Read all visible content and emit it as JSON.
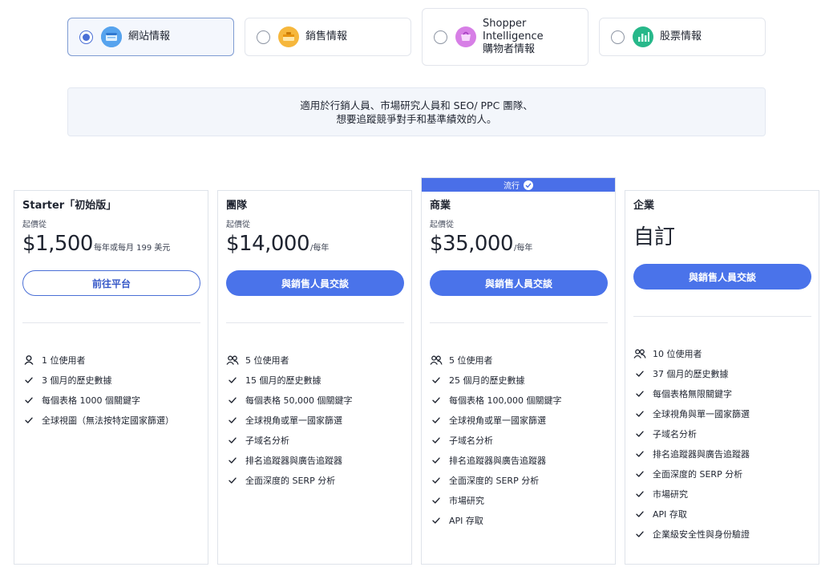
{
  "product_tabs": [
    {
      "label": "網站情報",
      "selected": true,
      "icon": "website-icon"
    },
    {
      "label": "銷售情報",
      "selected": false,
      "icon": "sales-icon"
    },
    {
      "label": "Shopper\nIntelligence\n購物者情報",
      "selected": false,
      "icon": "shopper-icon"
    },
    {
      "label": "股票情報",
      "selected": false,
      "icon": "stock-icon"
    }
  ],
  "banner": {
    "line1": "適用於行銷人員、市場研究人員和 SEO/ PPC 團隊、",
    "line2": "想要追蹤競爭對手和基準績效的人。"
  },
  "popular_label": "流行",
  "plans": [
    {
      "name": "Starter「初始版」",
      "price_from": "起價從",
      "price": "$1,500",
      "price_suffix": "每年或每月 199 美元",
      "cta": "前往平台",
      "features": [
        {
          "icon": "user-icon",
          "text": "1 位使用者"
        },
        {
          "icon": "check-icon",
          "text": "3 個月的歷史數據"
        },
        {
          "icon": "check-icon",
          "text": "每個表格 1000 個關鍵字"
        },
        {
          "icon": "check-icon",
          "text": "全球視圖（無法按特定國家篩選）"
        }
      ]
    },
    {
      "name": "團隊",
      "price_from": "起價從",
      "price": "$14,000",
      "price_suffix": "/每年",
      "cta": "與銷售人員交談",
      "features": [
        {
          "icon": "users-icon",
          "text": "5 位使用者"
        },
        {
          "icon": "check-icon",
          "text": "15 個月的歷史數據"
        },
        {
          "icon": "check-icon",
          "text": "每個表格 50,000 個關鍵字"
        },
        {
          "icon": "check-icon",
          "text": "全球視角或單一國家篩選"
        },
        {
          "icon": "check-icon",
          "text": "子域名分析"
        },
        {
          "icon": "check-icon",
          "text": "排名追蹤器與廣告追蹤器"
        },
        {
          "icon": "check-icon",
          "text": "全面深度的 SERP 分析"
        }
      ]
    },
    {
      "name": "商業",
      "price_from": "起價從",
      "price": "$35,000",
      "price_suffix": "/每年",
      "cta": "與銷售人員交談",
      "features": [
        {
          "icon": "users-icon",
          "text": "5 位使用者"
        },
        {
          "icon": "check-icon",
          "text": "25 個月的歷史數據"
        },
        {
          "icon": "check-icon",
          "text": "每個表格 100,000 個關鍵字"
        },
        {
          "icon": "check-icon",
          "text": "全球視角或單一國家篩選"
        },
        {
          "icon": "check-icon",
          "text": "子域名分析"
        },
        {
          "icon": "check-icon",
          "text": "排名追蹤器與廣告追蹤器"
        },
        {
          "icon": "check-icon",
          "text": "全面深度的 SERP 分析"
        },
        {
          "icon": "check-icon",
          "text": "市場研究"
        },
        {
          "icon": "check-icon",
          "text": "API 存取"
        }
      ]
    },
    {
      "name": "企業",
      "price_custom": "自訂",
      "cta": "與銷售人員交談",
      "features": [
        {
          "icon": "users-icon",
          "text": "10 位使用者"
        },
        {
          "icon": "check-icon",
          "text": "37 個月的歷史數據"
        },
        {
          "icon": "check-icon",
          "text": "每個表格無限關鍵字"
        },
        {
          "icon": "check-icon",
          "text": "全球視角與單一國家篩選"
        },
        {
          "icon": "check-icon",
          "text": "子域名分析"
        },
        {
          "icon": "check-icon",
          "text": "排名追蹤器與廣告追蹤器"
        },
        {
          "icon": "check-icon",
          "text": "全面深度的 SERP 分析"
        },
        {
          "icon": "check-icon",
          "text": "市場研究"
        },
        {
          "icon": "check-icon",
          "text": "API 存取"
        },
        {
          "icon": "check-icon",
          "text": "企業級安全性與身份驗證"
        }
      ]
    }
  ]
}
